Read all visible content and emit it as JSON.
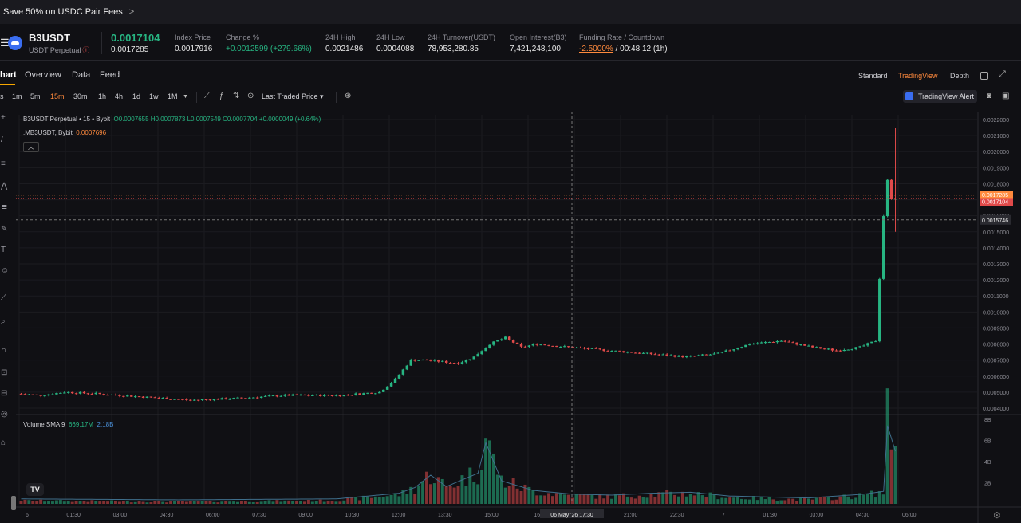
{
  "promo": {
    "text": "Save 50% on USDC Pair Fees"
  },
  "ticker": {
    "symbol": "B3USDT",
    "subtitle": "USDT Perpetual",
    "last_price": "0.0017104",
    "mark_price": "0.0017285",
    "stats": [
      {
        "label": "Index Price",
        "value": "0.0017916"
      },
      {
        "label": "Change %",
        "value": "+0.0012599 (+279.66%)"
      },
      {
        "label": "24H High",
        "value": "0.0021486"
      },
      {
        "label": "24H Low",
        "value": "0.0004088"
      },
      {
        "label": "24H Turnover(USDT)",
        "value": "78,953,280.85"
      },
      {
        "label": "Open Interest(B3)",
        "value": "7,421,248,100"
      },
      {
        "label": "Funding Rate / Countdown",
        "value_rate": "-2.5000%",
        "value_countdown": " / 00:48:12 (1h)"
      }
    ]
  },
  "tabs": [
    "hart",
    "Overview",
    "Data",
    "Feed"
  ],
  "view_options": [
    "Standard",
    "TradingView",
    "Depth"
  ],
  "toolbar": {
    "timeframes": [
      "s",
      "1m",
      "5m",
      "15m",
      "30m",
      "1h",
      "4h",
      "1d",
      "1w",
      "1M"
    ],
    "active_timeframe": "15m",
    "price_source": "Last Traded Price",
    "alert_label": "TradingView Alert"
  },
  "legend": {
    "line1_prefix": "B3USDT Perpetual • 15 • Bybit",
    "ohlc": "O0.0007655 H0.0007873 L0.0007549 C0.0007704 +0.0000049 (+0.64%)",
    "line2_prefix": ".MB3USDT, Bybit",
    "line2_value": "0.0007696",
    "volume_prefix": "Volume SMA 9",
    "volume_value": "669.17M",
    "volume_sma": "2.18B"
  },
  "colors": {
    "up": "#27b582",
    "down": "#e04a4a",
    "accent": "#ff8a3d",
    "bg": "#101014"
  },
  "chart_data": {
    "type": "candlestick",
    "title": "B3USDT Perpetual • 15 • Bybit",
    "price_axis_labels": [
      "0.0022000",
      "0.0021000",
      "0.0020000",
      "0.0019000",
      "0.0018000",
      "0.0017000",
      "0.0016000",
      "0.0015000",
      "0.0014000",
      "0.0013000",
      "0.0012000",
      "0.0011000",
      "0.0010000",
      "0.0009000",
      "0.0008000",
      "0.0007000",
      "0.0006000",
      "0.0005000",
      "0.0004000"
    ],
    "price_range": [
      0.00037,
      0.00223
    ],
    "volume_axis_labels": [
      "8B",
      "6B",
      "4B",
      "2B"
    ],
    "volume_range": [
      0,
      8.3
    ],
    "time_axis_labels": [
      "6",
      "01:30",
      "03:00",
      "04:30",
      "06:00",
      "07:30",
      "09:00",
      "10:30",
      "12:00",
      "13:30",
      "15:00",
      "16:",
      "19:30",
      "21:00",
      "22:30",
      "7",
      "01:30",
      "03:00",
      "04:30",
      "06:00"
    ],
    "crosshair_time": "06 May '26  17:30",
    "crosshair_price": "0.0015746",
    "price_tags": [
      {
        "value": "0.0017285",
        "kind": "mark"
      },
      {
        "value": "0.0017104",
        "kind": "last"
      }
    ],
    "price_anchors": [
      [
        0,
        0.00049
      ],
      [
        6,
        0.00048
      ],
      [
        12,
        0.0005
      ],
      [
        20,
        0.00049
      ],
      [
        32,
        0.00047
      ],
      [
        44,
        0.00045
      ],
      [
        55,
        0.00046
      ],
      [
        68,
        0.00048
      ],
      [
        82,
        0.00048
      ],
      [
        92,
        0.0005
      ],
      [
        96,
        0.00058
      ],
      [
        100,
        0.0007
      ],
      [
        104,
        0.0007
      ],
      [
        112,
        0.00068
      ],
      [
        116,
        0.00072
      ],
      [
        120,
        0.0008
      ],
      [
        124,
        0.00084
      ],
      [
        128,
        0.00078
      ],
      [
        132,
        0.0008
      ],
      [
        140,
        0.00078
      ],
      [
        150,
        0.00076
      ],
      [
        160,
        0.00074
      ],
      [
        170,
        0.00072
      ],
      [
        178,
        0.00074
      ],
      [
        186,
        0.0008
      ],
      [
        194,
        0.00082
      ],
      [
        202,
        0.00078
      ],
      [
        208,
        0.00076
      ],
      [
        214,
        0.00078
      ],
      [
        218,
        0.00082
      ],
      [
        220,
        0.0016
      ],
      [
        221,
        0.00182
      ],
      [
        222,
        0.00171
      ]
    ],
    "volume_anchors": [
      [
        0,
        0.3
      ],
      [
        40,
        0.2
      ],
      [
        80,
        0.3
      ],
      [
        96,
        0.9
      ],
      [
        100,
        1.5
      ],
      [
        104,
        2.8
      ],
      [
        108,
        1.6
      ],
      [
        116,
        3.0
      ],
      [
        118,
        6.2
      ],
      [
        122,
        2.2
      ],
      [
        130,
        1.2
      ],
      [
        140,
        0.8
      ],
      [
        150,
        0.7
      ],
      [
        160,
        0.9
      ],
      [
        170,
        1.0
      ],
      [
        180,
        0.6
      ],
      [
        200,
        0.4
      ],
      [
        214,
        0.8
      ],
      [
        219,
        1.1
      ],
      [
        220,
        8.0
      ],
      [
        222,
        5.3
      ]
    ]
  }
}
